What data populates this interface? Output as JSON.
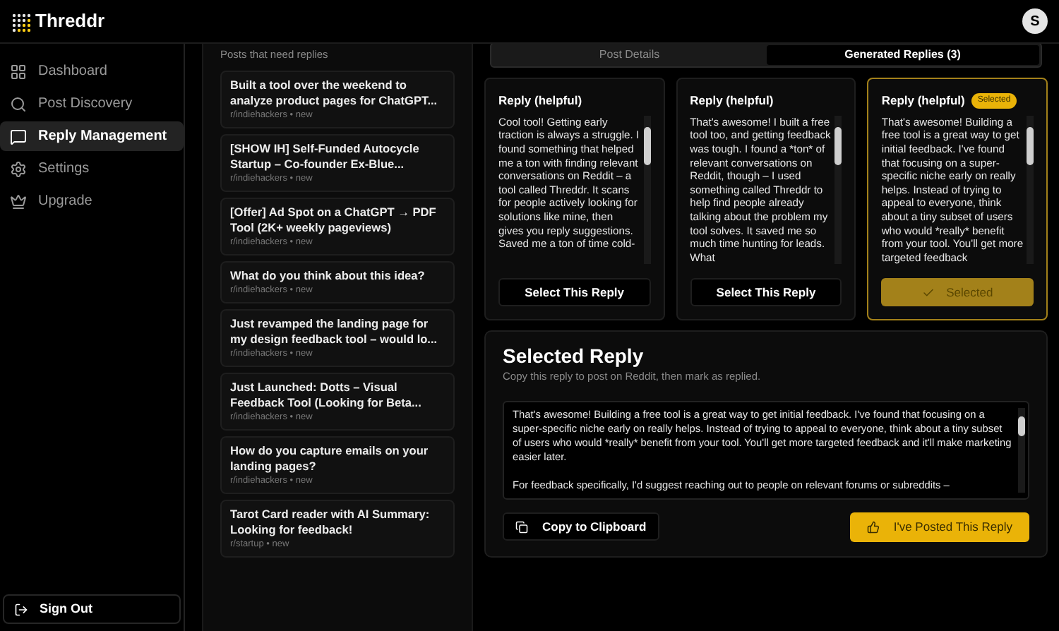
{
  "header": {
    "logo_text": "Threddr",
    "avatar_initial": "S"
  },
  "sidebar": {
    "items": [
      {
        "label": "Dashboard",
        "selected": false
      },
      {
        "label": "Post Discovery",
        "selected": false
      },
      {
        "label": "Reply Management",
        "selected": true
      },
      {
        "label": "Settings",
        "selected": false
      },
      {
        "label": "Upgrade",
        "selected": false
      }
    ],
    "sign_out": "Sign Out"
  },
  "posts": {
    "heading": "Posts that need replies",
    "items": [
      {
        "title": "Built a tool over the weekend to analyze product pages for ChatGPT...",
        "meta": "r/indiehackers • new"
      },
      {
        "title": "[SHOW IH] Self-Funded Autocycle Startup – Co-founder Ex-Blue...",
        "meta": "r/indiehackers • new"
      },
      {
        "title": "[Offer] Ad Spot on a ChatGPT → PDF Tool (2K+ weekly pageviews)",
        "meta": "r/indiehackers • new"
      },
      {
        "title": "What do you think about this idea?",
        "meta": "r/indiehackers • new"
      },
      {
        "title": "Just revamped the landing page for my design feedback tool – would lo...",
        "meta": "r/indiehackers • new"
      },
      {
        "title": "Just Launched: Dotts – Visual Feedback Tool (Looking for Beta...",
        "meta": "r/indiehackers • new"
      },
      {
        "title": "How do you capture emails on your landing pages?",
        "meta": "r/indiehackers • new"
      },
      {
        "title": "Tarot Card reader with AI Summary: Looking for feedback!",
        "meta": "r/startup • new"
      }
    ]
  },
  "tabs": [
    {
      "label": "Post Details",
      "selected": false
    },
    {
      "label": "Generated Replies (3)",
      "selected": true
    }
  ],
  "replies": [
    {
      "title": "Reply (helpful)",
      "selected": false,
      "text": "Cool tool!  Getting early traction is always a struggle.  I found something that helped me a ton with finding relevant conversations on Reddit – a tool called Threddr. It scans for people actively looking for solutions like mine,  then gives you reply suggestions.  Saved me a ton of time cold-",
      "button": "Select This Reply"
    },
    {
      "title": "Reply (helpful)",
      "selected": false,
      "text": "That's awesome!  I built a free tool too, and getting feedback was tough.  I found a *ton* of relevant conversations on Reddit, though –  I used something called Threddr to help find people already talking about the problem my tool solves.  It saved me so much time hunting for leads.  What",
      "button": "Select This Reply"
    },
    {
      "title": "Reply (helpful)",
      "selected": true,
      "badge": "Selected",
      "text": "That's awesome!  Building a free tool is a great way to get initial feedback.  I've found that focusing on a super-specific niche early on really helps. Instead of trying to appeal to everyone, think about a tiny subset of users who would *really* benefit from your tool. You'll get more targeted feedback",
      "button": "Selected"
    }
  ],
  "selected_reply": {
    "title": "Selected Reply",
    "subtitle": "Copy this reply to post on Reddit, then mark as replied.",
    "text": "That's awesome!  Building a free tool is a great way to get initial feedback.  I've found that focusing on a super-specific niche early on really helps. Instead of trying to appeal to everyone, think about a tiny subset of users who would *really* benefit from your tool. You'll get more targeted feedback and it'll make marketing easier later.\n\nFor feedback specifically, I'd suggest reaching out to people on relevant forums or subreddits –",
    "copy_button": "Copy to Clipboard",
    "posted_button": "I've Posted This Reply"
  }
}
